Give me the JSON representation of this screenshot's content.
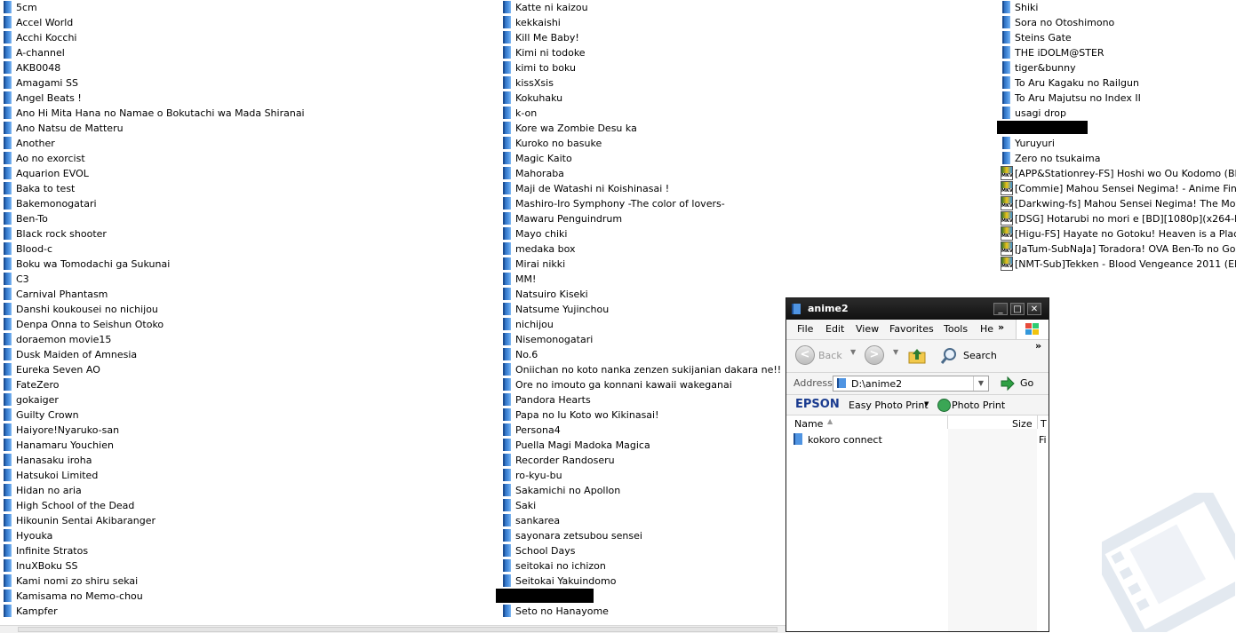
{
  "desktop": {
    "column1": [
      "5cm",
      "Accel World",
      "Acchi Kocchi",
      "A-channel",
      "AKB0048",
      "Amagami SS",
      "Angel Beats !",
      "Ano Hi Mita Hana no Namae o Bokutachi wa Mada Shiranai",
      "Ano Natsu de Matteru",
      "Another",
      "Ao no exorcist",
      "Aquarion EVOL",
      "Baka to test",
      "Bakemonogatari",
      "Ben-To",
      "Black rock shooter",
      "Blood-c",
      "Boku wa Tomodachi ga Sukunai",
      "C3",
      "Carnival Phantasm",
      "Danshi koukousei no nichijou",
      "Denpa Onna to Seishun Otoko",
      "doraemon movie15",
      "Dusk Maiden of Amnesia",
      "Eureka Seven AO",
      "FateZero",
      "gokaiger",
      "Guilty Crown",
      "Haiyore!Nyaruko-san",
      "Hanamaru Youchien",
      "Hanasaku iroha",
      "Hatsukoi Limited",
      "Hidan no aria",
      "High School of the Dead",
      "Hikounin Sentai Akibaranger",
      "Hyouka",
      "Infinite Stratos",
      "InuXBoku SS",
      "Kami nomi zo shiru sekai",
      "Kamisama no Memo-chou",
      "Kampfer"
    ],
    "column2": [
      "Katte ni kaizou",
      "kekkaishi",
      "Kill Me Baby!",
      "Kimi ni todoke",
      "kimi to boku",
      "kissXsis",
      "Kokuhaku",
      "k-on",
      "Kore wa Zombie Desu ka",
      "Kuroko no basuke",
      "Magic Kaito",
      "Mahoraba",
      "Maji de Watashi ni Koishinasai !",
      "Mashiro-Iro Symphony -The color of lovers-",
      "Mawaru Penguindrum",
      "Mayo chiki",
      "medaka box",
      "Mirai nikki",
      "MM!",
      "Natsuiro Kiseki",
      "Natsume Yujinchou",
      "nichijou",
      "Nisemonogatari",
      "No.6",
      "Oniichan no koto nanka zenzen sukijanian dakara ne!!",
      "Ore no imouto ga konnani kawaii wakeganai",
      "Pandora Hearts",
      "Papa no Iu Koto wo Kikinasai!",
      "Persona4",
      "Puella Magi Madoka Magica",
      "Recorder Randoseru",
      "ro-kyu-bu",
      "Sakamichi no Apollon",
      "Saki",
      "sankarea",
      "sayonara zetsubou sensei",
      "School Days",
      "seitokai no ichizon",
      "Seitokai Yakuindomo",
      "",
      "Seto no Hanayome"
    ],
    "column3_folders": [
      "Shiki",
      "Sora no Otoshimono",
      "Steins Gate",
      "THE iDOLM@STER",
      "tiger&bunny",
      "To Aru Kagaku no Railgun",
      "To Aru Majutsu no Index II",
      "usagi drop",
      "",
      "Yuruyuri",
      "Zero no tsukaima"
    ],
    "column3_files": [
      "[APP&Stationrey-FS] Hoshi wo Ou Kodomo (BD 1280",
      "[Commie] Mahou Sensei Negima! - Anime Final [DVD",
      "[Darkwing-fs] Mahou Sensei Negima! The Movie - AN",
      "[DSG] Hotarubi no mori e [BD][1080p](x264-FLAC)[0",
      "[Higu-FS] Hayate no Gotoku! Heaven is a Place on E",
      "[JaTum-SubNaJa] Toradora! OVA Ben-To no Gokui (",
      "[NMT-Sub]Tekken - Blood Vengeance 2011 (EN BD72"
    ],
    "file_icon_label": "MKV"
  },
  "window": {
    "title": "anime2",
    "controls": {
      "minimize": "_",
      "maximize": "□",
      "close": "✕"
    },
    "menu": [
      "File",
      "Edit",
      "View",
      "Favorites",
      "Tools",
      "He"
    ],
    "menu_overflow": "»",
    "toolbar": {
      "back": "Back",
      "search": "Search",
      "overflow": "»"
    },
    "address": {
      "label": "Address",
      "value": "D:\\anime2",
      "go": "Go"
    },
    "epson": {
      "brand": "EPSON",
      "easy_photo_print": "Easy Photo Print",
      "photo_print": "Photo Print"
    },
    "columns": {
      "name": "Name",
      "size": "Size",
      "type": "T"
    },
    "items": [
      {
        "name": "kokoro connect",
        "type": "Fi"
      }
    ]
  }
}
